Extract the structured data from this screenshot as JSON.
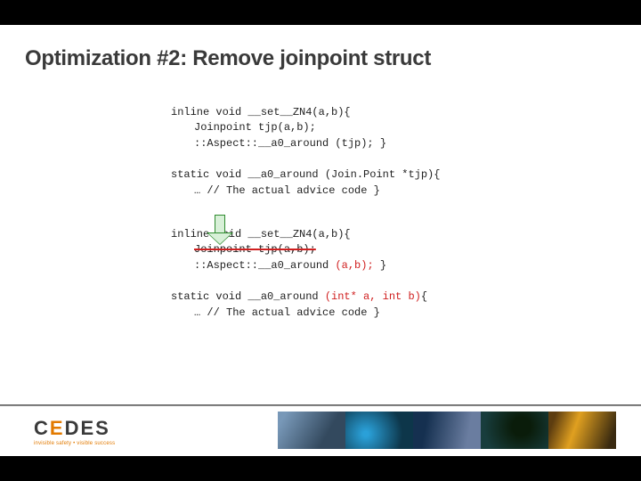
{
  "title": "Optimization #2: Remove joinpoint struct",
  "code1": {
    "l1": "inline void __set__ZN4(a,b){",
    "l2": "Joinpoint tjp(a,b);",
    "l3": "::Aspect::__a0_around (tjp); }"
  },
  "code2": {
    "l1": "static void __a0_around (Join.Point *tjp){",
    "l2": "… // The actual advice code }"
  },
  "code3": {
    "l1": "inline void __set__ZN4(a,b){",
    "l2": "Joinpoint tjp(a,b);",
    "l3a": "::Aspect::__a0_around ",
    "l3b": "(a,b);",
    "l3c": " }"
  },
  "code4": {
    "l1a": "static void __a0_around ",
    "l1b": "(int* a, int b)",
    "l1c": "{",
    "l2": "… // The actual advice code }"
  },
  "logo": {
    "text_pre": "C",
    "text_orange": "E",
    "text_post": "DES",
    "sub": "invisible safety • visible success"
  }
}
